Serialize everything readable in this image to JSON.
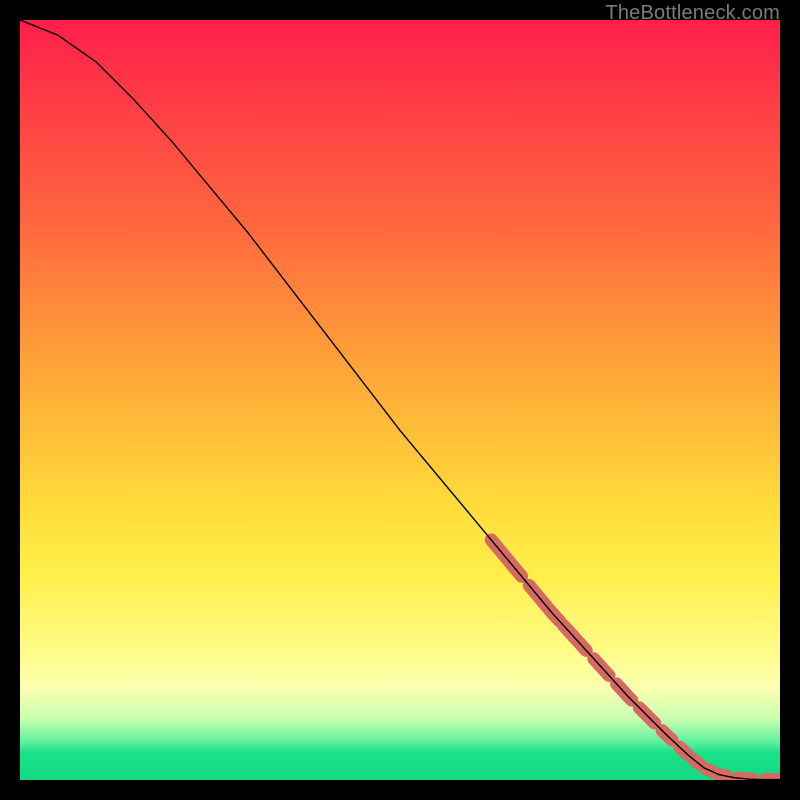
{
  "watermark": "TheBottleneck.com",
  "colors": {
    "dash": "#d66a62",
    "curve": "#000000"
  },
  "chart_data": {
    "type": "line",
    "title": "",
    "xlabel": "",
    "ylabel": "",
    "xlim": [
      0,
      100
    ],
    "ylim": [
      0,
      100
    ],
    "grid": false,
    "series": [
      {
        "name": "curve",
        "x": [
          0,
          5,
          10,
          15,
          20,
          25,
          30,
          35,
          40,
          45,
          50,
          55,
          60,
          65,
          70,
          75,
          80,
          85,
          88,
          90,
          92,
          94,
          96,
          98,
          100
        ],
        "y": [
          100,
          98,
          94.5,
          89.5,
          84,
          78,
          72,
          65.5,
          59,
          52.5,
          46,
          40,
          34,
          28,
          22,
          16.5,
          11,
          6,
          3.2,
          1.6,
          0.7,
          0.3,
          0.1,
          0.05,
          0.05
        ]
      }
    ],
    "highlight_dash_ranges_x": [
      [
        62,
        66
      ],
      [
        67,
        71
      ],
      [
        71.5,
        74.5
      ],
      [
        75.5,
        77.5
      ],
      [
        78.5,
        80.5
      ],
      [
        81.5,
        83.5
      ],
      [
        84.5,
        85.8
      ],
      [
        86.8,
        87.8
      ],
      [
        88.6,
        89.4
      ],
      [
        90.2,
        91.0
      ],
      [
        92.0,
        93.0
      ],
      [
        94.5,
        96.5
      ],
      [
        98.0,
        100.0
      ]
    ],
    "annotations": []
  }
}
